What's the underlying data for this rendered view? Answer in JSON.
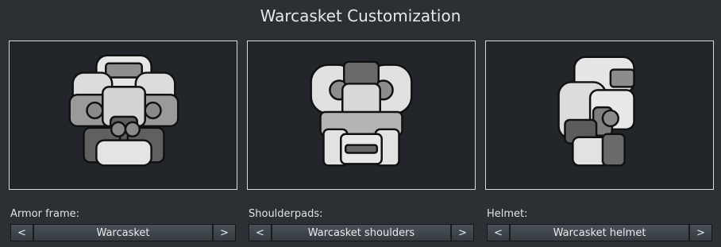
{
  "title": "Warcasket Customization",
  "armor": {
    "label": "Armor frame:",
    "value": "Warcasket",
    "prev": "<",
    "next": ">"
  },
  "shoulders": {
    "label": "Shoulderpads:",
    "value": "Warcasket shoulders",
    "prev": "<",
    "next": ">"
  },
  "helmet": {
    "label": "Helmet:",
    "value": "Warcasket helmet",
    "prev": "<",
    "next": ">"
  },
  "colors": {
    "background": "#2c2f33",
    "panel_background": "#22262a",
    "panel_border": "#d7dadd",
    "armor_light": "#e8e8e8",
    "armor_mid": "#9a9a9a",
    "armor_dark": "#5e5e5e"
  }
}
